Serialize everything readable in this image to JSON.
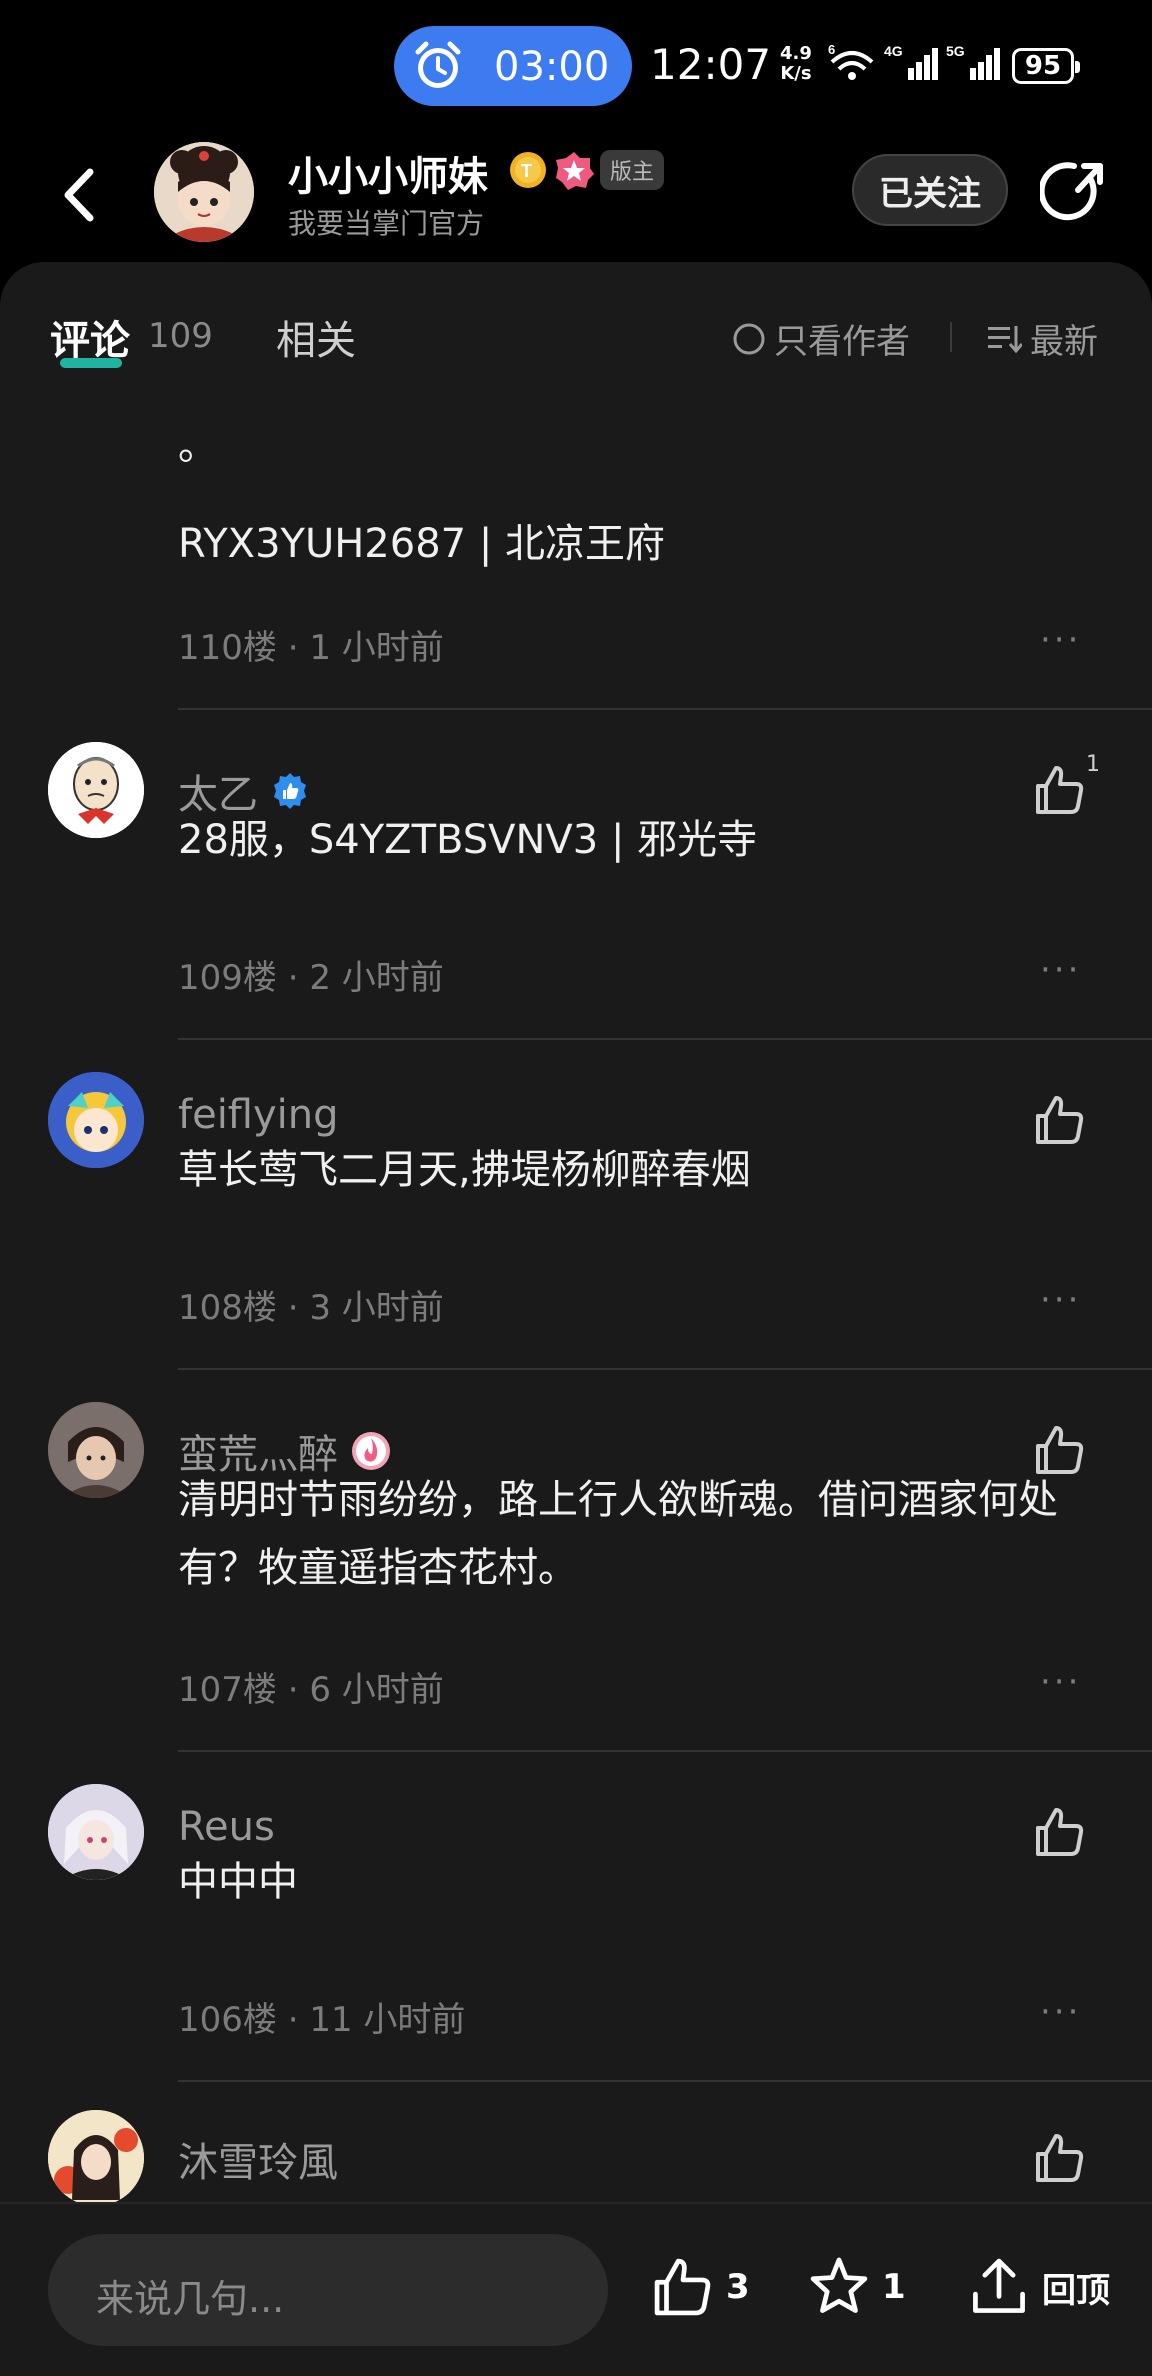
{
  "status_bar": {
    "alarm_time": "03:00",
    "clock": "12:07",
    "net_speed_value": "4.9",
    "net_speed_unit": "K/s",
    "wifi_label": "6",
    "signal1_label": "4G",
    "signal2_label": "5G",
    "battery": "95"
  },
  "header": {
    "author_name": "小小小师妹",
    "author_subtitle": "我要当掌门官方",
    "moderator_badge": "版主",
    "follow_label": "已关注"
  },
  "tabs": {
    "comments_label": "评论",
    "comments_count": "109",
    "related_label": "相关",
    "author_only_label": "只看作者",
    "sort_label": "最新"
  },
  "comments": [
    {
      "text_line1": "。",
      "text_line2": "RYX3YUH2687 | 北凉王府",
      "floor": "110楼",
      "time": "1 小时前"
    },
    {
      "name": "太乙",
      "text": "28服，S4YZTBSVNV3 | 邪光寺",
      "floor": "109楼",
      "time": "2 小时前",
      "likes": "1"
    },
    {
      "name": "feiflying",
      "text": "草长莺飞二月天,拂堤杨柳醉春烟",
      "floor": "108楼",
      "time": "3 小时前"
    },
    {
      "name": "蛮荒灬醉",
      "text_line1": "清明时节雨纷纷，路上行人欲断魂。借问酒家何处",
      "text_line2": "有？牧童遥指杏花村。",
      "floor": "107楼",
      "time": "6 小时前"
    },
    {
      "name": "Reus",
      "text": "中中中",
      "floor": "106楼",
      "time": "11 小时前"
    },
    {
      "name": "沐雪玲風"
    }
  ],
  "bottom_bar": {
    "input_placeholder": "来说几句...",
    "like_count": "3",
    "star_count": "1",
    "back_top_label": "回顶"
  },
  "colors": {
    "accent_blue": "#3d7cf0",
    "tab_underline": "#1fb3a4",
    "background": "#1a1a1a"
  },
  "icons": [
    "alarm-icon",
    "wifi-icon",
    "signal-icon",
    "back-icon",
    "share-icon",
    "like-icon",
    "star-icon",
    "upload-icon",
    "more-icon",
    "sort-icon",
    "verified-icon"
  ]
}
